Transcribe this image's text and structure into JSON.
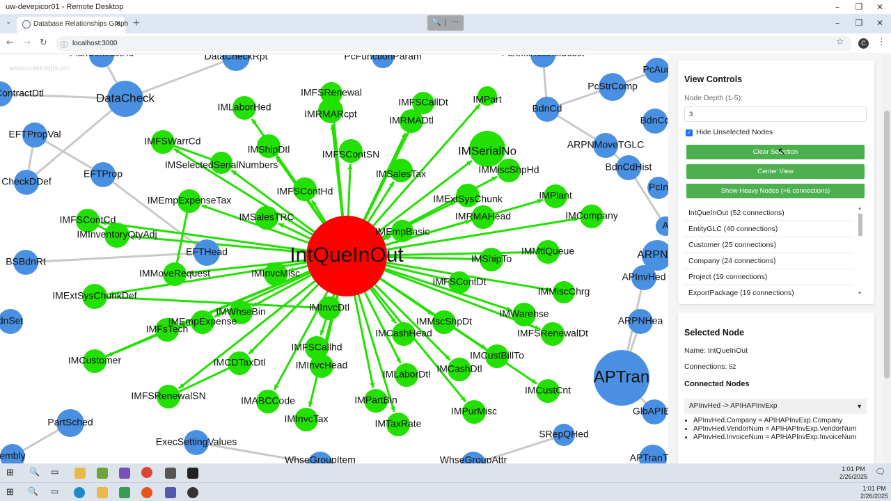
{
  "remote_desktop": {
    "title": "uw-devepicor01 - Remote Desktop",
    "buttons": [
      "–",
      "❐",
      "✕"
    ]
  },
  "browser": {
    "tab_title": "Database Relationships Graph",
    "url": "localhost:3000",
    "profile_initial": "C"
  },
  "graph": {
    "watermark": "www.conncepts.pro",
    "center_node": "IntQueInOut",
    "center_color": "#ff0000",
    "green_color": "#22e000",
    "blue_color": "#4a90e2",
    "gray_edge": "#c8c8c8",
    "green_nodes": [
      {
        "name": "IMFSRenewal"
      },
      {
        "name": "IMFSCallDt"
      },
      {
        "name": "IMPart"
      },
      {
        "name": "IMLaborHed"
      },
      {
        "name": "IMRMARcpt"
      },
      {
        "name": "IMRMADtl"
      },
      {
        "name": "IMShipDtl"
      },
      {
        "name": "IMFSWarrCd"
      },
      {
        "name": "IMFSContSN"
      },
      {
        "name": "IMSerialNo"
      },
      {
        "name": "IMSelectedSerialNumbers"
      },
      {
        "name": "IMSalesTax"
      },
      {
        "name": "IMMiscShpHd"
      },
      {
        "name": "IMFSContHd"
      },
      {
        "name": "IMExtSysChunk"
      },
      {
        "name": "IMPlant"
      },
      {
        "name": "IMEmpExpenseTax"
      },
      {
        "name": "IMSalesTRC"
      },
      {
        "name": "IMRMAHead"
      },
      {
        "name": "IMCompany"
      },
      {
        "name": "IMFSContCd"
      },
      {
        "name": "IMEmpBasic"
      },
      {
        "name": "IMInventoryQtyAdj"
      },
      {
        "name": "IMMtlQueue"
      },
      {
        "name": "IMShipTo"
      },
      {
        "name": "IMMoveRequest"
      },
      {
        "name": "IMInvcMisc"
      },
      {
        "name": "IMFSContDt"
      },
      {
        "name": "IMExtSysChunkDef"
      },
      {
        "name": "IMMiscChrg"
      },
      {
        "name": "IMWhseBin"
      },
      {
        "name": "IMInvcDtl"
      },
      {
        "name": "IMEmpExpense"
      },
      {
        "name": "IMWarehse"
      },
      {
        "name": "IMMscShpDt"
      },
      {
        "name": "IMFsTech"
      },
      {
        "name": "IMCashHead"
      },
      {
        "name": "IMFSRenewalDt"
      },
      {
        "name": "IMFSCallhd"
      },
      {
        "name": "IMCustomer"
      },
      {
        "name": "IMCDTaxDtl"
      },
      {
        "name": "IMCustBillTo"
      },
      {
        "name": "IMInvcHead"
      },
      {
        "name": "IMCashDtl"
      },
      {
        "name": "IMLaborDtl"
      },
      {
        "name": "IMCustCnt"
      },
      {
        "name": "IMFSRenewalSN"
      },
      {
        "name": "IMABCCode"
      },
      {
        "name": "IMPartBin"
      },
      {
        "name": "IMPurMisc"
      },
      {
        "name": "IMInvcTax"
      },
      {
        "name": "IMTaxRate"
      }
    ],
    "blue_nodes": [
      {
        "name": "PlanContractHd"
      },
      {
        "name": "DataCheckRpt"
      },
      {
        "name": "PcFunctionParam"
      },
      {
        "name": "PartMtlRestrictSubst"
      },
      {
        "name": "PcAud"
      },
      {
        "name": "ContractDtl"
      },
      {
        "name": "DataCheck"
      },
      {
        "name": "PcStrComp"
      },
      {
        "name": "BdnCd"
      },
      {
        "name": "BdnCd"
      },
      {
        "name": "EFTPropVal"
      },
      {
        "name": "ARPNMoveTGLC"
      },
      {
        "name": "BdnCdHist"
      },
      {
        "name": "EFTProp"
      },
      {
        "name": "CheckDDef"
      },
      {
        "name": "PcIn"
      },
      {
        "name": "A"
      },
      {
        "name": "ARPNM"
      },
      {
        "name": "EFTHead"
      },
      {
        "name": "BSBdnRt"
      },
      {
        "name": "APInvHed"
      },
      {
        "name": "ARPNHea"
      },
      {
        "name": "dnSet"
      },
      {
        "name": "APTran"
      },
      {
        "name": "GlbAPIET"
      },
      {
        "name": "PartSched"
      },
      {
        "name": "ExecSettingValues"
      },
      {
        "name": "SRepQHed"
      },
      {
        "name": "APTranTG"
      },
      {
        "name": "embly"
      },
      {
        "name": "WhseGroupItem"
      },
      {
        "name": "WhseGroupAttr"
      }
    ]
  },
  "view_controls": {
    "title": "View Controls",
    "depth_label": "Node Depth (1-5):",
    "depth_value": "3",
    "hide_label": "Hide Unselected Nodes",
    "hide_checked": true,
    "btn_clear": "Clear Selection",
    "btn_center": "Center View",
    "btn_heavy": "Show Heavy Nodes (>6 connections)",
    "button_color": "#4caf50",
    "heavy_nodes": [
      "IntQueInOut (52 connections)",
      "EntityGLC (40 connections)",
      "Customer (25 connections)",
      "Company (24 connections)",
      "Project (19 connections)",
      "ExportPackage (19 connections)"
    ]
  },
  "selected_node": {
    "title": "Selected Node",
    "name_label": "Name:",
    "name": "IntQueInOut",
    "conn_label": "Connections:",
    "connections": "52",
    "connected_title": "Connected Nodes",
    "selected_relation": "APInvHed -> APIHAPInvExp",
    "details": [
      "APInvHed.Company = APIHAPInvExp.Company",
      "APInvHed.VendorNum = APIHAPInvExp.VendorNum",
      "APInvHed.InvoiceNum = APIHAPInvExp.InvoiceNum"
    ]
  },
  "taskbar": {
    "time": "1:01 PM",
    "date": "2/26/2025"
  }
}
